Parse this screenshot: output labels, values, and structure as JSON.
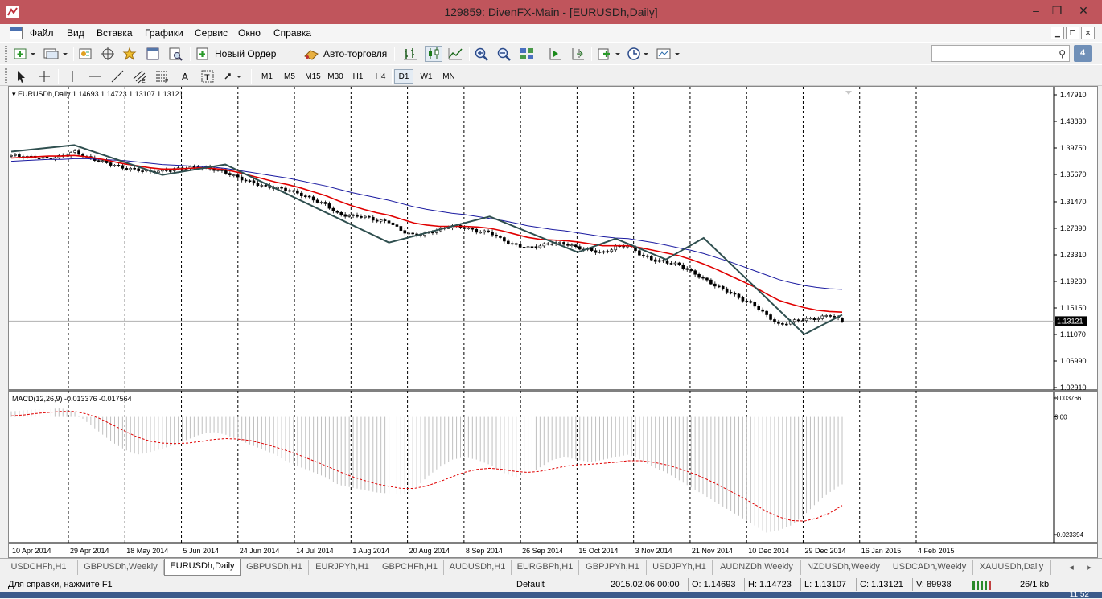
{
  "window": {
    "title": "129859: DivenFX-Main - [EURUSDh,Daily]",
    "minimize_icon": "–",
    "restore_icon": "❐",
    "close_icon": "✕"
  },
  "menu": {
    "items": [
      "Файл",
      "Вид",
      "Вставка",
      "Графики",
      "Сервис",
      "Окно",
      "Справка"
    ]
  },
  "toolbar": {
    "new_order_label": "Новый Ордер",
    "auto_trading_label": "Авто-торговля",
    "search_placeholder": "",
    "notify_count": "4"
  },
  "timeframes": [
    "M1",
    "M5",
    "M15",
    "M30",
    "H1",
    "H4",
    "D1",
    "W1",
    "MN"
  ],
  "active_timeframe": "D1",
  "chart_data": [
    {
      "type": "candlestick",
      "title": "EURUSDh,Daily  1.14693 1.14723 1.13107 1.13121",
      "symbol": "EURUSDh",
      "timeframe": "Daily",
      "ohlc": {
        "open": 1.14693,
        "high": 1.14723,
        "low": 1.13107,
        "close": 1.13121
      },
      "current_price_label": "1.13121",
      "y_ticks": [
        "1.47910",
        "1.43830",
        "1.39750",
        "1.35670",
        "1.31470",
        "1.27390",
        "1.23310",
        "1.19230",
        "1.15150",
        "1.11070",
        "1.06990",
        "1.02910"
      ],
      "ylim": [
        1.0291,
        1.4791
      ],
      "x_labels": [
        "10 Apr 2014",
        "29 Apr 2014",
        "18 May 2014",
        "5 Jun 2014",
        "24 Jun 2014",
        "14 Jul 2014",
        "1 Aug 2014",
        "20 Aug 2014",
        "8 Sep 2014",
        "26 Sep 2014",
        "15 Oct 2014",
        "3 Nov 2014",
        "21 Nov 2014",
        "10 Dec 2014",
        "29 Dec 2014",
        "16 Jan 2015",
        "4 Feb 2015"
      ],
      "close_path": [
        1.386,
        1.384,
        1.383,
        1.381,
        1.385,
        1.392,
        1.383,
        1.378,
        1.372,
        1.366,
        1.364,
        1.361,
        1.362,
        1.365,
        1.367,
        1.368,
        1.365,
        1.36,
        1.352,
        1.345,
        1.339,
        1.336,
        1.333,
        1.326,
        1.318,
        1.31,
        1.295,
        1.293,
        1.292,
        1.286,
        1.284,
        1.27,
        1.263,
        1.266,
        1.272,
        1.278,
        1.275,
        1.269,
        1.268,
        1.256,
        1.248,
        1.244,
        1.247,
        1.252,
        1.25,
        1.244,
        1.24,
        1.236,
        1.245,
        1.248,
        1.233,
        1.225,
        1.222,
        1.218,
        1.207,
        1.196,
        1.185,
        1.176,
        1.165,
        1.156,
        1.14,
        1.125,
        1.131,
        1.134,
        1.135,
        1.141,
        1.131
      ],
      "ma_red": [
        1.382,
        1.383,
        1.384,
        1.385,
        1.385,
        1.386,
        1.384,
        1.381,
        1.377,
        1.373,
        1.37,
        1.367,
        1.365,
        1.365,
        1.366,
        1.367,
        1.366,
        1.364,
        1.36,
        1.355,
        1.35,
        1.345,
        1.341,
        1.336,
        1.33,
        1.324,
        1.316,
        1.309,
        1.303,
        1.298,
        1.294,
        1.288,
        1.282,
        1.279,
        1.277,
        1.277,
        1.277,
        1.276,
        1.274,
        1.27,
        1.265,
        1.26,
        1.257,
        1.256,
        1.255,
        1.253,
        1.25,
        1.247,
        1.247,
        1.247,
        1.244,
        1.24,
        1.236,
        1.232,
        1.226,
        1.219,
        1.211,
        1.202,
        1.193,
        1.184,
        1.173,
        1.163,
        1.157,
        1.152,
        1.148,
        1.146,
        1.145
      ],
      "ma_blue": [
        1.377,
        1.378,
        1.379,
        1.38,
        1.38,
        1.381,
        1.381,
        1.38,
        1.379,
        1.378,
        1.376,
        1.374,
        1.372,
        1.371,
        1.37,
        1.369,
        1.368,
        1.366,
        1.363,
        1.36,
        1.357,
        1.354,
        1.351,
        1.347,
        1.343,
        1.339,
        1.334,
        1.329,
        1.325,
        1.321,
        1.317,
        1.312,
        1.307,
        1.303,
        1.3,
        1.297,
        1.295,
        1.292,
        1.289,
        1.286,
        1.282,
        1.278,
        1.275,
        1.272,
        1.27,
        1.267,
        1.264,
        1.261,
        1.259,
        1.258,
        1.255,
        1.252,
        1.248,
        1.244,
        1.24,
        1.235,
        1.229,
        1.223,
        1.216,
        1.209,
        1.202,
        1.195,
        1.19,
        1.186,
        1.183,
        1.181,
        1.18
      ],
      "zigzag": [
        [
          0,
          1.392
        ],
        [
          5,
          1.402
        ],
        [
          12,
          1.356
        ],
        [
          17,
          1.372
        ],
        [
          30,
          1.252
        ],
        [
          38,
          1.292
        ],
        [
          45,
          1.237
        ],
        [
          48,
          1.258
        ],
        [
          52,
          1.226
        ],
        [
          55,
          1.259
        ],
        [
          63,
          1.111
        ],
        [
          66,
          1.141
        ]
      ]
    },
    {
      "type": "bar",
      "title": "MACD(12,26,9) -0.013376 -0.017564",
      "macd_main": -0.013376,
      "macd_signal": -0.017564,
      "y_ticks": [
        "0.003766",
        "0.00",
        "-0.023394"
      ],
      "ylim": [
        -0.023394,
        0.003766
      ],
      "histogram": [
        0.0011,
        0.0013,
        0.0015,
        0.0016,
        0.0017,
        0.001,
        -0.001,
        -0.003,
        -0.005,
        -0.0065,
        -0.0075,
        -0.007,
        -0.0063,
        -0.0055,
        -0.0045,
        -0.0035,
        -0.003,
        -0.0035,
        -0.0045,
        -0.0055,
        -0.0065,
        -0.0075,
        -0.009,
        -0.01,
        -0.011,
        -0.012,
        -0.0135,
        -0.014,
        -0.0145,
        -0.015,
        -0.0152,
        -0.0155,
        -0.0145,
        -0.012,
        -0.01,
        -0.0085,
        -0.008,
        -0.0085,
        -0.0095,
        -0.011,
        -0.012,
        -0.0115,
        -0.01,
        -0.0085,
        -0.008,
        -0.0085,
        -0.009,
        -0.0085,
        -0.008,
        -0.0075,
        -0.0085,
        -0.01,
        -0.011,
        -0.0125,
        -0.014,
        -0.0155,
        -0.017,
        -0.0185,
        -0.02,
        -0.0215,
        -0.023,
        -0.0225,
        -0.0215,
        -0.0195,
        -0.017,
        -0.015,
        -0.0134
      ],
      "signal": [
        0.0002,
        0.0004,
        0.0007,
        0.0009,
        0.0011,
        0.0011,
        0.0006,
        -0.0003,
        -0.0015,
        -0.0028,
        -0.004,
        -0.0048,
        -0.0052,
        -0.0053,
        -0.0052,
        -0.0049,
        -0.0045,
        -0.0043,
        -0.0044,
        -0.0047,
        -0.0053,
        -0.006,
        -0.0068,
        -0.0077,
        -0.0087,
        -0.0097,
        -0.0108,
        -0.0118,
        -0.0126,
        -0.0133,
        -0.0138,
        -0.0142,
        -0.0142,
        -0.0137,
        -0.0129,
        -0.0119,
        -0.011,
        -0.0104,
        -0.0102,
        -0.0104,
        -0.0108,
        -0.011,
        -0.0108,
        -0.0103,
        -0.0098,
        -0.0095,
        -0.0094,
        -0.0092,
        -0.009,
        -0.0087,
        -0.0087,
        -0.009,
        -0.0095,
        -0.0102,
        -0.0111,
        -0.0121,
        -0.0133,
        -0.0146,
        -0.0159,
        -0.0173,
        -0.0188,
        -0.0199,
        -0.0206,
        -0.0207,
        -0.0201,
        -0.0191,
        -0.0176
      ]
    }
  ],
  "tabs": [
    "USDCHFh,H1",
    "GBPUSDh,Weekly",
    "EURUSDh,Daily",
    "GBPUSDh,H1",
    "EURJPYh,H1",
    "GBPCHFh,H1",
    "AUDUSDh,H1",
    "EURGBPh,H1",
    "GBPJPYh,H1",
    "USDJPYh,H1",
    "AUDNZDh,Weekly",
    "NZDUSDh,Weekly",
    "USDCADh,Weekly",
    "XAUUSDh,Daily"
  ],
  "active_tab": "EURUSDh,Daily",
  "status": {
    "help": "Для справки, нажмите F1",
    "profile": "Default",
    "datetime": "2015.02.06 00:00",
    "open": "O: 1.14693",
    "high": "H: 1.14723",
    "low": "L: 1.13107",
    "close": "C: 1.13121",
    "volume": "V: 89938",
    "traffic": "26/1 kb"
  },
  "taskbar": {
    "clock": "11:52"
  },
  "colors": {
    "titlebar": "#c0555c",
    "ma_red": "#e00000",
    "ma_blue": "#1a1aa0",
    "zigzag": "#2f4f4f",
    "macd_signal": "#e00000",
    "macd_hist": "#c0c0c0"
  }
}
